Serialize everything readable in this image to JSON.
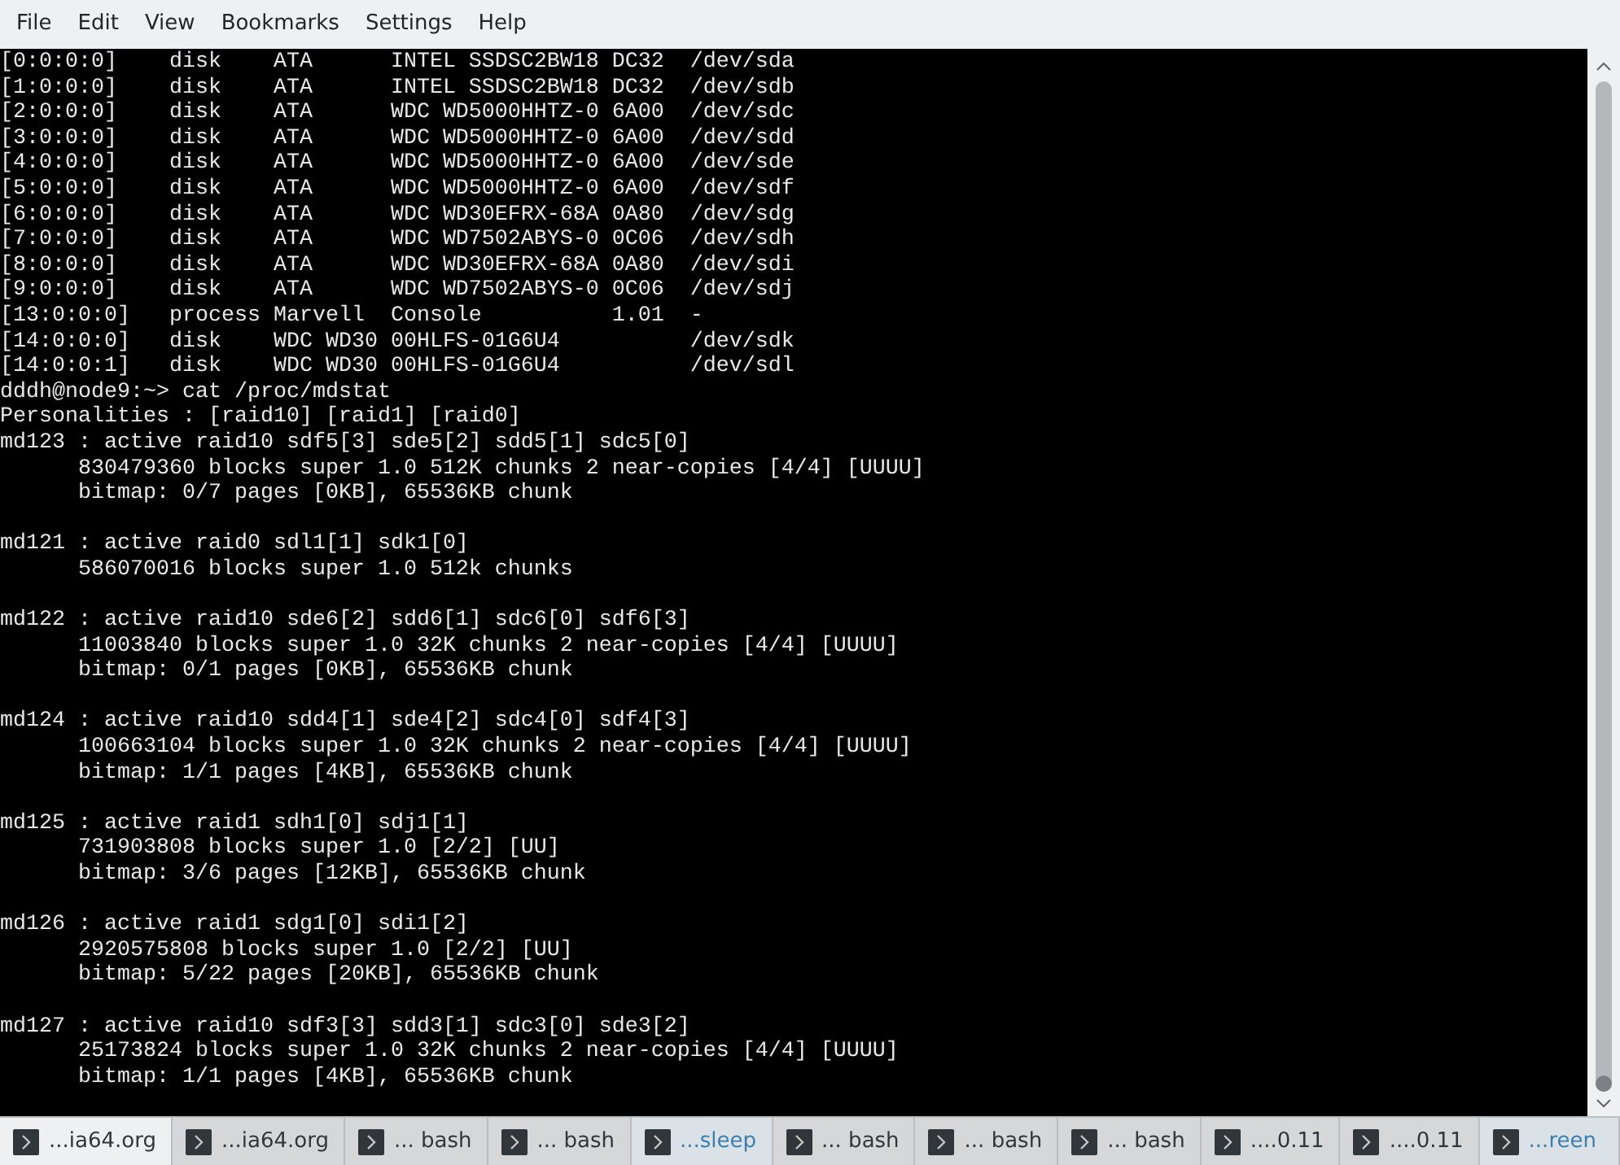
{
  "menu": [
    "File",
    "Edit",
    "View",
    "Bookmarks",
    "Settings",
    "Help"
  ],
  "terminal_blocks": [
    [
      "[0:0:0:0]    disk    ATA      INTEL SSDSC2BW18 DC32  /dev/sda",
      "[1:0:0:0]    disk    ATA      INTEL SSDSC2BW18 DC32  /dev/sdb",
      "[2:0:0:0]    disk    ATA      WDC WD5000HHTZ-0 6A00  /dev/sdc",
      "[3:0:0:0]    disk    ATA      WDC WD5000HHTZ-0 6A00  /dev/sdd",
      "[4:0:0:0]    disk    ATA      WDC WD5000HHTZ-0 6A00  /dev/sde",
      "[5:0:0:0]    disk    ATA      WDC WD5000HHTZ-0 6A00  /dev/sdf",
      "[6:0:0:0]    disk    ATA      WDC WD30EFRX-68A 0A80  /dev/sdg",
      "[7:0:0:0]    disk    ATA      WDC WD7502ABYS-0 0C06  /dev/sdh",
      "[8:0:0:0]    disk    ATA      WDC WD30EFRX-68A 0A80  /dev/sdi",
      "[9:0:0:0]    disk    ATA      WDC WD7502ABYS-0 0C06  /dev/sdj",
      "[13:0:0:0]   process Marvell  Console          1.01  -",
      "[14:0:0:0]   disk    WDC WD30 00HLFS-01G6U4          /dev/sdk",
      "[14:0:0:1]   disk    WDC WD30 00HLFS-01G6U4          /dev/sdl",
      "dddh@node9:~> cat /proc/mdstat",
      "Personalities : [raid10] [raid1] [raid0]",
      "md123 : active raid10 sdf5[3] sde5[2] sdd5[1] sdc5[0]",
      "      830479360 blocks super 1.0 512K chunks 2 near-copies [4/4] [UUUU]",
      "      bitmap: 0/7 pages [0KB], 65536KB chunk"
    ],
    [
      "md121 : active raid0 sdl1[1] sdk1[0]",
      "      586070016 blocks super 1.0 512k chunks"
    ],
    [
      "md122 : active raid10 sde6[2] sdd6[1] sdc6[0] sdf6[3]",
      "      11003840 blocks super 1.0 32K chunks 2 near-copies [4/4] [UUUU]",
      "      bitmap: 0/1 pages [0KB], 65536KB chunk"
    ],
    [
      "md124 : active raid10 sdd4[1] sde4[2] sdc4[0] sdf4[3]",
      "      100663104 blocks super 1.0 32K chunks 2 near-copies [4/4] [UUUU]",
      "      bitmap: 1/1 pages [4KB], 65536KB chunk"
    ],
    [
      "md125 : active raid1 sdh1[0] sdj1[1]",
      "      731903808 blocks super 1.0 [2/2] [UU]",
      "      bitmap: 3/6 pages [12KB], 65536KB chunk"
    ],
    [
      "md126 : active raid1 sdg1[0] sdi1[2]",
      "      2920575808 blocks super 1.0 [2/2] [UU]",
      "      bitmap: 5/22 pages [20KB], 65536KB chunk"
    ],
    [
      "md127 : active raid10 sdf3[3] sdd3[1] sdc3[0] sde3[2]",
      "      25173824 blocks super 1.0 32K chunks 2 near-copies [4/4] [UUUU]",
      "      bitmap: 1/1 pages [4KB], 65536KB chunk"
    ]
  ],
  "tabs": [
    {
      "label": "...ia64.org",
      "selected": true,
      "activity": false
    },
    {
      "label": "...ia64.org",
      "selected": false,
      "activity": false
    },
    {
      "label": "... bash",
      "selected": false,
      "activity": false
    },
    {
      "label": "... bash",
      "selected": false,
      "activity": false
    },
    {
      "label": "...sleep",
      "selected": false,
      "activity": true
    },
    {
      "label": "... bash",
      "selected": false,
      "activity": false
    },
    {
      "label": "... bash",
      "selected": false,
      "activity": false
    },
    {
      "label": "... bash",
      "selected": false,
      "activity": false
    },
    {
      "label": "....0.11",
      "selected": false,
      "activity": false
    },
    {
      "label": "....0.11",
      "selected": false,
      "activity": false
    },
    {
      "label": "...reen",
      "selected": false,
      "activity": true
    }
  ]
}
